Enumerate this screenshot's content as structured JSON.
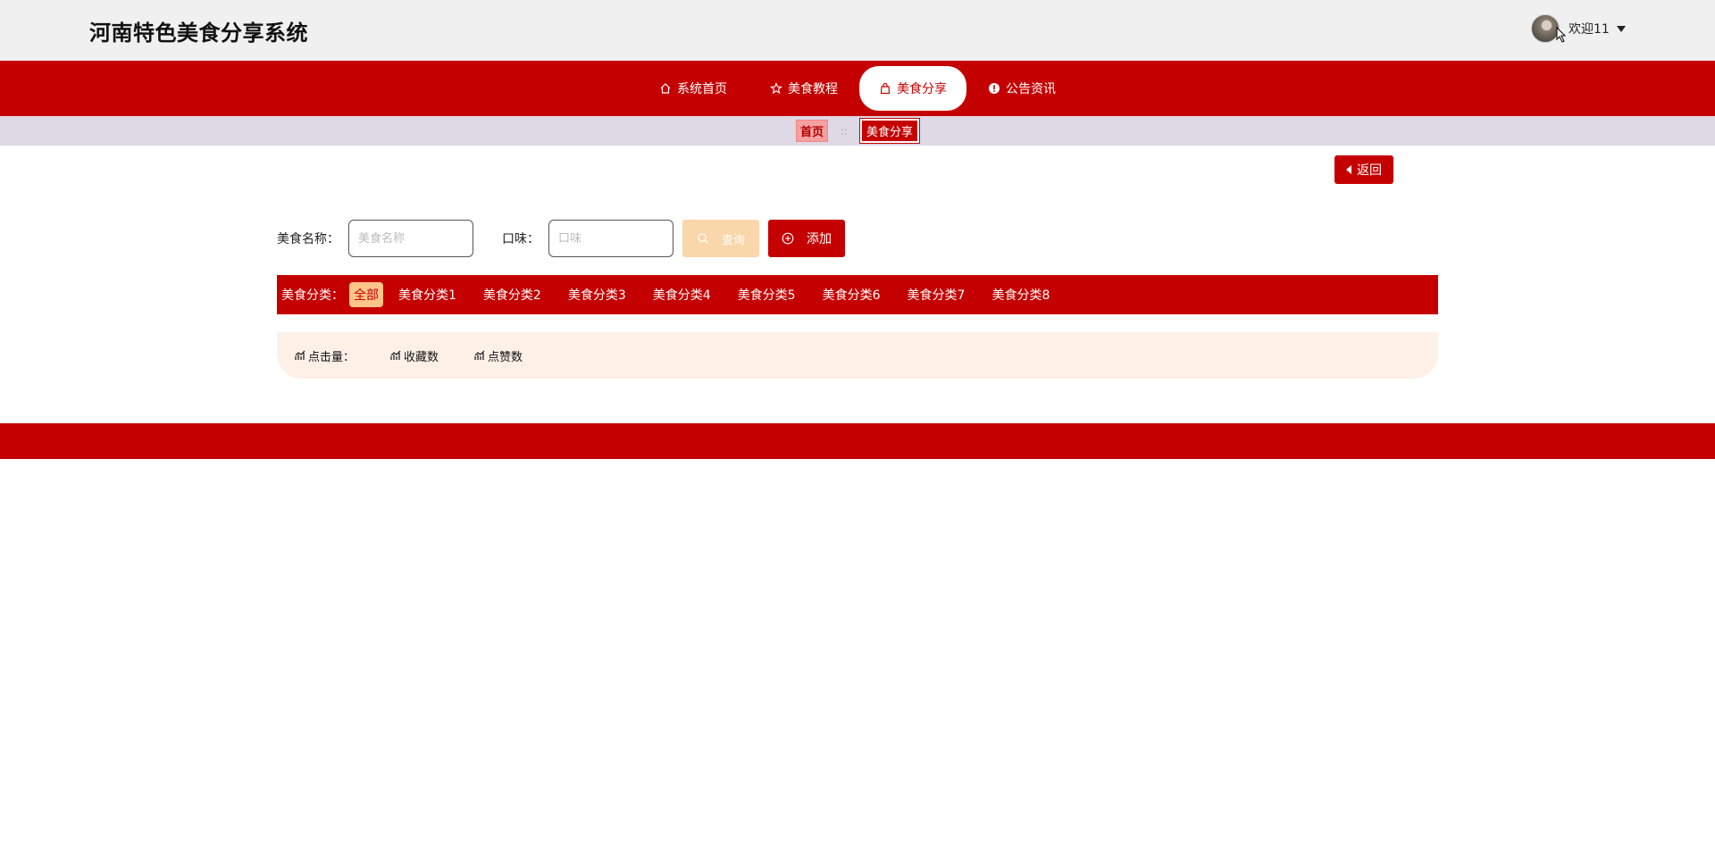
{
  "header": {
    "site_title": "河南特色美食分享系统",
    "welcome_text": "欢迎11"
  },
  "nav": {
    "items": [
      {
        "label": "系统首页",
        "icon": "home-icon"
      },
      {
        "label": "美食教程",
        "icon": "star-icon"
      },
      {
        "label": "美食分享",
        "icon": "bag-icon",
        "active": true
      },
      {
        "label": "公告资讯",
        "icon": "alert-icon"
      }
    ]
  },
  "breadcrumb": {
    "home": "首页",
    "separator": "::",
    "current": "美食分享"
  },
  "back_button": {
    "label": "返回"
  },
  "search": {
    "name_label": "美食名称：",
    "name_placeholder": "美食名称",
    "taste_label": "口味：",
    "taste_placeholder": "口味",
    "query_label": "查询",
    "add_label": "添加"
  },
  "categories": {
    "label": "美食分类：",
    "items": [
      "全部",
      "美食分类1",
      "美食分类2",
      "美食分类3",
      "美食分类4",
      "美食分类5",
      "美食分类6",
      "美食分类7",
      "美食分类8"
    ],
    "active": "全部"
  },
  "sort": {
    "items": [
      "点击量：",
      "收藏数",
      "点赞数"
    ]
  },
  "colors": {
    "primary": "#c50000",
    "topbar_bg": "#f0f0f0",
    "breadcrumb_bg": "#dfd8e5",
    "query_btn": "#fad6ab",
    "sort_bg": "#fdf0e7"
  }
}
